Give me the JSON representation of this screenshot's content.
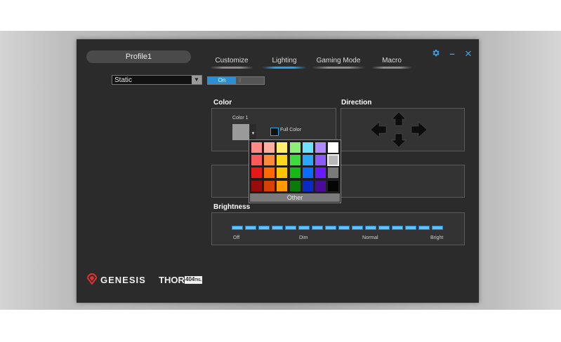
{
  "profile": {
    "name": "Profile1"
  },
  "tabs": [
    {
      "label": "Customize",
      "active": false
    },
    {
      "label": "Lighting",
      "active": true
    },
    {
      "label": "Gaming Mode",
      "active": false
    },
    {
      "label": "Macro",
      "active": false
    }
  ],
  "window_controls": {
    "settings_icon": "gear-icon",
    "minimize": "–",
    "close": "✕"
  },
  "effect_select": {
    "value": "Static"
  },
  "power_toggle": {
    "label": "On",
    "state": "on"
  },
  "color_section": {
    "title": "Color",
    "color1_label": "Color 1",
    "color1_value": "#9a9a9a",
    "full_color_label": "Full Color"
  },
  "direction_section": {
    "title": "Direction"
  },
  "palette": {
    "rows": [
      [
        "#ff8a8a",
        "#ffb0a0",
        "#ffee70",
        "#8dee7a",
        "#70e0ff",
        "#b08aff",
        "#ffffff"
      ],
      [
        "#ff5a5a",
        "#ff8a3a",
        "#ffd81a",
        "#3cdc3c",
        "#2aa6ff",
        "#8a5aff",
        "#b8b8b8"
      ],
      [
        "#e81818",
        "#ff6a00",
        "#ffc400",
        "#15b815",
        "#0a6cff",
        "#6a1aff",
        "#7a7a7a"
      ],
      [
        "#9a0c0c",
        "#d84000",
        "#ff9a00",
        "#0a7a0a",
        "#0a2ac8",
        "#4a0a9a",
        "#050505"
      ]
    ],
    "other_label": "Other"
  },
  "brightness": {
    "title": "Brightness",
    "labels": [
      "Off",
      "Dim",
      "Normal",
      "Bright"
    ],
    "level": 1.0,
    "segments": 16
  },
  "brand": {
    "logo_icon": "genesis-logo-icon",
    "name": "GENESIS",
    "product": "THOR",
    "model": "404",
    "model_suffix": "TKL"
  },
  "colors": {
    "accent": "#2aa3e6",
    "window_bg": "#2b2b2b",
    "panel_bg": "#333333"
  }
}
